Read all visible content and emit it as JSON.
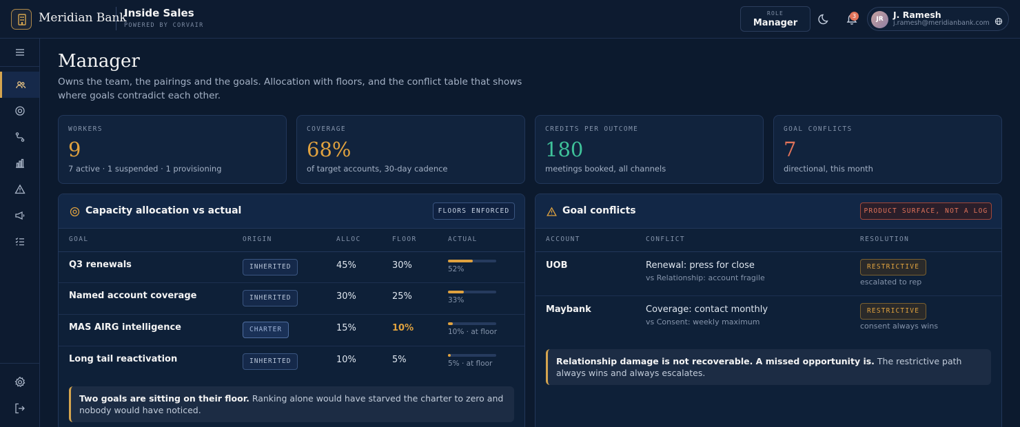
{
  "header": {
    "bank_name": "Meridian Bank",
    "app_title": "Inside Sales",
    "app_subtitle": "POWERED BY CORVAIR",
    "role_label": "ROLE",
    "role_value": "Manager",
    "notification_count": "3",
    "user": {
      "initials": "JR",
      "name": "J. Ramesh",
      "email": "j.ramesh@meridianbank.com"
    }
  },
  "sidebar": {
    "items": [
      {
        "icon": "menu-icon"
      },
      {
        "icon": "team-icon",
        "active": true
      },
      {
        "icon": "target-icon"
      },
      {
        "icon": "route-icon"
      },
      {
        "icon": "bar-chart-icon"
      },
      {
        "icon": "warning-icon"
      },
      {
        "icon": "megaphone-icon"
      },
      {
        "icon": "checklist-icon"
      },
      {
        "icon": "gear-icon"
      },
      {
        "icon": "logout-icon"
      }
    ]
  },
  "page": {
    "title": "Manager",
    "description": "Owns the team, the pairings and the goals. Allocation with floors, and the conflict table that shows where goals contradict each other."
  },
  "stats": [
    {
      "label": "WORKERS",
      "value": "9",
      "sub": "7 active · 1 suspended · 1 provisioning",
      "color": "#e0a23f"
    },
    {
      "label": "COVERAGE",
      "value": "68%",
      "sub": "of target accounts, 30-day cadence",
      "color": "#e0a23f"
    },
    {
      "label": "CREDITS PER OUTCOME",
      "value": "180",
      "sub": "meetings booked, all channels",
      "color": "#3fc29a"
    },
    {
      "label": "GOAL CONFLICTS",
      "value": "7",
      "sub": "directional, this month",
      "color": "#e2735a"
    }
  ],
  "allocation": {
    "title": "Capacity allocation vs actual",
    "badge": "FLOORS ENFORCED",
    "columns": {
      "goal": "GOAL",
      "origin": "ORIGIN",
      "alloc": "ALLOC",
      "floor": "FLOOR",
      "actual": "ACTUAL"
    },
    "rows": [
      {
        "goal": "Q3 renewals",
        "origin": "INHERITED",
        "alloc": "45%",
        "floor": "30%",
        "actual": 0.52,
        "actual_text": "52%"
      },
      {
        "goal": "Named account coverage",
        "origin": "INHERITED",
        "alloc": "30%",
        "floor": "25%",
        "actual": 0.33,
        "actual_text": "33%"
      },
      {
        "goal": "MAS AIRG intelligence",
        "origin": "CHARTER",
        "alloc": "15%",
        "floor": "10%",
        "actual": 0.1,
        "actual_text": "10% · at floor"
      },
      {
        "goal": "Long tail reactivation",
        "origin": "INHERITED",
        "alloc": "10%",
        "floor": "5%",
        "actual": 0.05,
        "actual_text": "5% · at floor"
      }
    ],
    "note_bold": "Two goals are sitting on their floor.",
    "note_text": " Ranking alone would have starved the charter to zero and nobody would have noticed."
  },
  "conflicts": {
    "title": "Goal conflicts",
    "badge": "PRODUCT SURFACE, NOT A LOG",
    "columns": {
      "account": "ACCOUNT",
      "conflict": "CONFLICT",
      "resolution": "RESOLUTION"
    },
    "rows": [
      {
        "account": "UOB",
        "conflict": "Renewal: press for close",
        "versus": "vs Relationship: account fragile",
        "resolution": "RESTRICTIVE",
        "resolution_note": "escalated to rep"
      },
      {
        "account": "Maybank",
        "conflict": "Coverage: contact monthly",
        "versus": "vs Consent: weekly maximum",
        "resolution": "RESTRICTIVE",
        "resolution_note": "consent always wins"
      }
    ],
    "note_bold": "Relationship damage is not recoverable. A missed opportunity is.",
    "note_text": " The restrictive path always wins and always escalates."
  }
}
